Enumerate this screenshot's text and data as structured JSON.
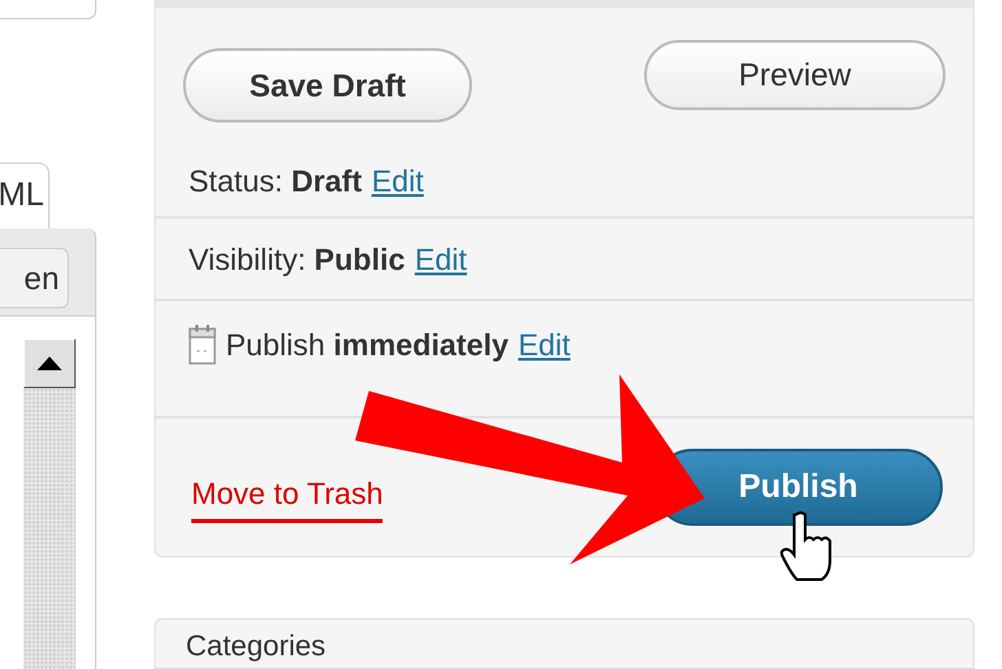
{
  "editor": {
    "tab": {
      "label": "ML",
      "selected": true
    },
    "toolbar_button": "en"
  },
  "publish_box": {
    "buttons": [
      "Save Draft",
      "Preview"
    ],
    "rows": [
      {
        "kind": "status",
        "text": "Status: **Draft**",
        "link": "Edit"
      },
      {
        "kind": "visibility",
        "text": "Visibility: **Public**",
        "link": "Edit"
      },
      {
        "kind": "schedule",
        "text": "Publish **immediately**",
        "link": "Edit"
      }
    ],
    "trash_link": "Move to Trash",
    "publish_button": "Publish"
  },
  "categories_box": {
    "title": "Categories"
  }
}
